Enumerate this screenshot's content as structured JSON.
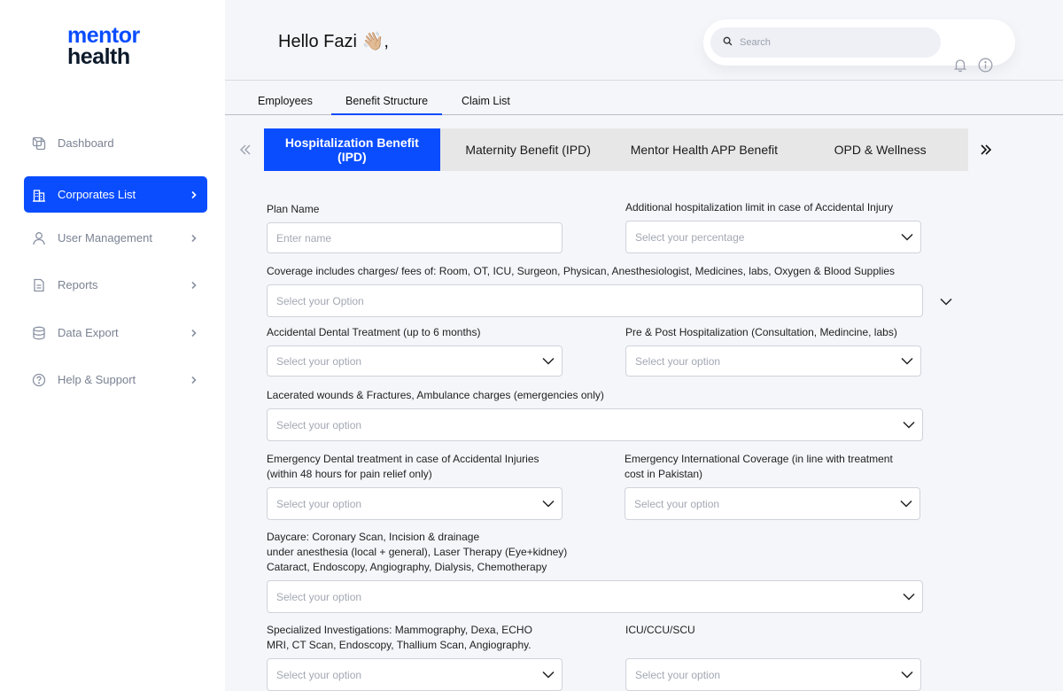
{
  "brand": {
    "line1": "mentor",
    "line2": "health"
  },
  "sidebar": {
    "items": [
      {
        "label": "Dashboard",
        "icon": "dashboard-icon",
        "has_chevron": false,
        "active": false
      },
      {
        "label": "Corporates List",
        "icon": "building-icon",
        "has_chevron": true,
        "active": true
      },
      {
        "label": "User Management",
        "icon": "user-icon",
        "has_chevron": true,
        "active": false
      },
      {
        "label": "Reports",
        "icon": "document-icon",
        "has_chevron": true,
        "active": false
      },
      {
        "label": "Data Export",
        "icon": "database-icon",
        "has_chevron": true,
        "active": false
      },
      {
        "label": "Help & Support",
        "icon": "help-icon",
        "has_chevron": true,
        "active": false
      }
    ]
  },
  "header": {
    "greeting": "Hello Fazi 👋🏼,",
    "search_placeholder": "Search",
    "icons": [
      "bell-icon",
      "info-icon"
    ]
  },
  "tabs": [
    {
      "label": "Employees",
      "active": false
    },
    {
      "label": "Benefit Structure",
      "active": true
    },
    {
      "label": "Claim List",
      "active": false
    }
  ],
  "benefit_tabs": [
    {
      "label": "Hospitalization Benefit (IPD)",
      "active": true
    },
    {
      "label": "Maternity Benefit (IPD)",
      "active": false
    },
    {
      "label": "Mentor Health APP Benefit",
      "active": false
    },
    {
      "label": "OPD & Wellness",
      "active": false
    }
  ],
  "form": {
    "plan_name_label": "Plan Name",
    "plan_name_placeholder": "Enter name",
    "accidental_limit_label": "Additional hospitalization limit in case of Accidental Injury",
    "accidental_limit_placeholder": "Select your percentage",
    "coverage_label": "Coverage includes charges/ fees of: Room, OT, ICU, Surgeon, Physican, Anesthesiologist, Medicines, labs, Oxygen & Blood Supplies",
    "coverage_placeholder": "Select your Option",
    "dental_label": "Accidental Dental Treatment (up to 6 months)",
    "dental_placeholder": "Select your option",
    "pre_post_label": "Pre & Post Hospitalization (Consultation, Medincine, labs)",
    "pre_post_placeholder": "Select your option",
    "lacerated_label": "Lacerated wounds & Fractures, Ambulance charges (emergencies only)",
    "lacerated_placeholder": "Select your option",
    "emergency_dental_label_1": "Emergency Dental treatment in case of Accidental Injuries",
    "emergency_dental_label_2": "(within 48 hours for pain relief only)",
    "emergency_dental_placeholder": "Select your option",
    "intl_label_1": "Emergency International Coverage (in line with treatment",
    "intl_label_2": "cost in Pakistan)",
    "intl_placeholder": "Select your option",
    "daycare_label_1": "Daycare: Coronary Scan, Incision & drainage",
    "daycare_label_2": "under anesthesia (local + general), Laser Therapy (Eye+kidney)",
    "daycare_label_3": "Cataract, Endoscopy, Angiography, Dialysis, Chemotherapy",
    "daycare_placeholder": "Select your option",
    "specialized_label_1": "Specialized Investigations: Mammography, Dexa, ECHO",
    "specialized_label_2": "MRI, CT Scan, Endoscopy, Thallium Scan, Angiography.",
    "specialized_placeholder": "Select your option",
    "icu_label": "ICU/CCU/SCU",
    "icu_placeholder": "Select your option"
  }
}
